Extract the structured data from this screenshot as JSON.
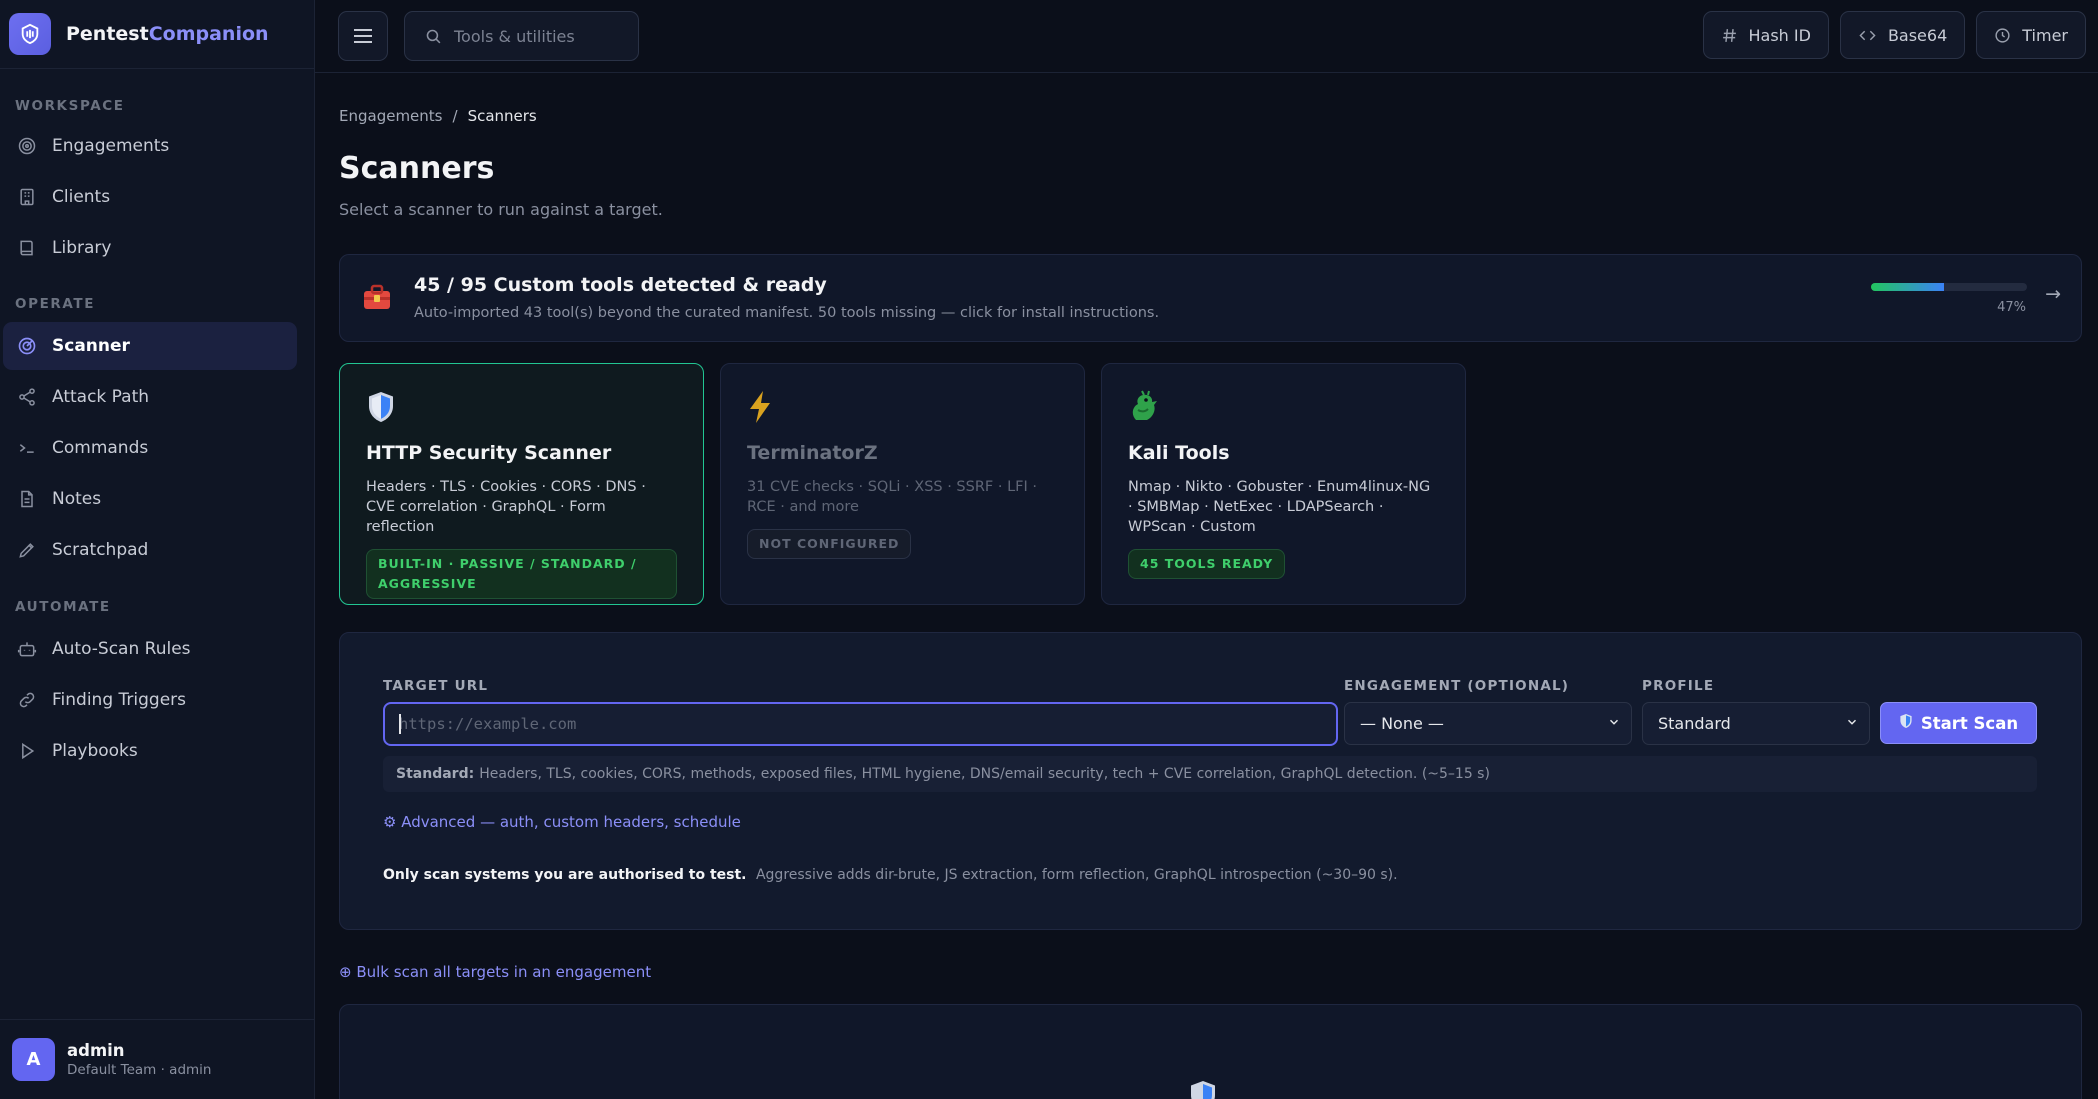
{
  "brand": {
    "name_part1": "Pentest",
    "name_part2": "Companion"
  },
  "sidebar": {
    "sections": [
      {
        "label": "WORKSPACE",
        "items": [
          {
            "label": "Engagements",
            "icon": "target-icon"
          },
          {
            "label": "Clients",
            "icon": "building-icon"
          },
          {
            "label": "Library",
            "icon": "book-icon"
          }
        ]
      },
      {
        "label": "OPERATE",
        "items": [
          {
            "label": "Scanner",
            "icon": "radar-icon",
            "active": true
          },
          {
            "label": "Attack Path",
            "icon": "share-nodes-icon"
          },
          {
            "label": "Commands",
            "icon": "terminal-icon"
          },
          {
            "label": "Notes",
            "icon": "file-text-icon"
          },
          {
            "label": "Scratchpad",
            "icon": "pen-icon"
          }
        ]
      },
      {
        "label": "AUTOMATE",
        "items": [
          {
            "label": "Auto-Scan Rules",
            "icon": "robot-icon"
          },
          {
            "label": "Finding Triggers",
            "icon": "link-icon"
          },
          {
            "label": "Playbooks",
            "icon": "play-icon"
          }
        ]
      }
    ],
    "user": {
      "initial": "A",
      "name": "admin",
      "team": "Default Team · admin"
    }
  },
  "topbar": {
    "search_placeholder": "Tools & utilities",
    "actions": [
      {
        "label": "Hash ID",
        "icon": "hash-icon"
      },
      {
        "label": "Base64",
        "icon": "code-icon"
      },
      {
        "label": "Timer",
        "icon": "clock-icon"
      }
    ]
  },
  "breadcrumb": {
    "parent": "Engagements",
    "separator": "/",
    "current": "Scanners"
  },
  "page": {
    "title": "Scanners",
    "subtitle": "Select a scanner to run against a target."
  },
  "tools_banner": {
    "icon": "toolbox-icon",
    "title": "45 / 95 Custom tools detected & ready",
    "description": "Auto-imported 43 tool(s) beyond the curated manifest. 50 tools missing — click for install instructions.",
    "progress_percent": 47,
    "progress_label": "47%",
    "arrow": "→"
  },
  "scanners": [
    {
      "emoji": "🛡️",
      "title": "HTTP Security Scanner",
      "description": "Headers · TLS · Cookies · CORS · DNS · CVE correlation · GraphQL · Form reflection",
      "badge": "BUILT-IN · PASSIVE / STANDARD / AGGRESSIVE",
      "state": "selected"
    },
    {
      "emoji": "⚡",
      "title": "TerminatorZ",
      "description": "31 CVE checks · SQLi · XSS · SSRF · LFI · RCE · and more",
      "badge": "NOT CONFIGURED",
      "state": "disabled"
    },
    {
      "emoji": "🐉",
      "title": "Kali Tools",
      "description": "Nmap · Nikto · Gobuster · Enum4linux-NG · SMBMap · NetExec · LDAPSearch · WPScan · Custom",
      "badge": "45 TOOLS READY",
      "state": "normal"
    }
  ],
  "scan_form": {
    "target_label": "TARGET URL",
    "target_placeholder": "https://example.com",
    "target_value": "",
    "engagement_label": "ENGAGEMENT (OPTIONAL)",
    "engagement_value": "— None —",
    "profile_label": "PROFILE",
    "profile_value": "Standard",
    "start_label": "Start Scan",
    "profile_hint_name": "Standard:",
    "profile_hint_text": "Headers, TLS, cookies, CORS, methods, exposed files, HTML hygiene, DNS/email security, tech + CVE correlation, GraphQL detection. (~5–15 s)",
    "advanced_link": "⚙ Advanced — auth, custom headers, schedule",
    "warning_bold": "Only scan systems you are authorised to test.",
    "warning_text": "Aggressive adds dir-brute, JS extraction, form reflection, GraphQL introspection (~30–90 s)."
  },
  "bulk_link": "⊕ Bulk scan all targets in an engagement",
  "colors": {
    "accent": "#6366f1",
    "success": "#22c55e",
    "selected_border": "#22c592",
    "background": "#0b0f1a"
  }
}
